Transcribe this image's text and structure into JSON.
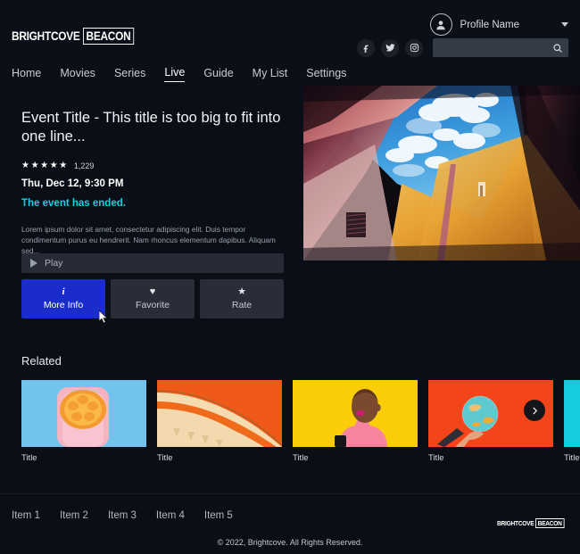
{
  "brand": {
    "logo_word": "BRIGHTCOVE",
    "logo_box": "BEACON"
  },
  "header": {
    "profile_name": "Profile Name",
    "profile_icon": "user-avatar-icon",
    "caret_icon": "chevron-down-icon",
    "social": [
      {
        "name": "facebook-icon",
        "glyph": "f"
      },
      {
        "name": "twitter-icon",
        "glyph": "t"
      },
      {
        "name": "instagram-icon",
        "glyph": "i"
      }
    ],
    "search": {
      "value": "",
      "placeholder": "",
      "icon": "search-icon"
    },
    "nav": [
      {
        "label": "Home",
        "active": false
      },
      {
        "label": "Movies",
        "active": false
      },
      {
        "label": "Series",
        "active": false
      },
      {
        "label": "Live",
        "active": true
      },
      {
        "label": "Guide",
        "active": false
      },
      {
        "label": "My List",
        "active": false
      },
      {
        "label": "Settings",
        "active": false
      }
    ]
  },
  "hero": {
    "title": "Event Title - This title is too big to fit into one line...",
    "stars": "★★★★★",
    "rating_value": 5,
    "rating_count": "1,229",
    "date": "Thu, Dec 12, 9:30 PM",
    "status": "The event has ended.",
    "status_color": "#17cfe0",
    "description": "Lorem ipsum dolor sit amet, consectetur adipiscing elit. Duis tempor condimentum purus eu hendrerit. Nam rhoncus elementum dapibus. Aliquam sed...",
    "image_alt": "upward-view-of-buildings-and-sky"
  },
  "actions": {
    "play": {
      "label": "Play",
      "icon": "play-triangle-icon"
    },
    "buttons": [
      {
        "label": "More Info",
        "icon": "info-icon",
        "glyph": "i",
        "primary": true,
        "accent": "#1a2cc9"
      },
      {
        "label": "Favorite",
        "icon": "heart-icon",
        "glyph": "♥",
        "primary": false
      },
      {
        "label": "Rate",
        "icon": "star-icon",
        "glyph": "★",
        "primary": false
      }
    ]
  },
  "related": {
    "heading": "Related",
    "next_icon": "chevron-right-icon",
    "cards": [
      {
        "title": "Title",
        "thumb": "orange-slice-on-pink-blue"
      },
      {
        "title": "Title",
        "thumb": "orange-architecture-arch"
      },
      {
        "title": "Title",
        "thumb": "woman-on-yellow-background"
      },
      {
        "title": "Title",
        "thumb": "hand-holding-globe-on-red"
      },
      {
        "title": "Title",
        "thumb": "cyan-partial-card"
      }
    ]
  },
  "footer": {
    "items": [
      "Item 1",
      "Item 2",
      "Item 3",
      "Item 4",
      "Item 5"
    ],
    "copyright": "© 2022, Brightcove. All Rights Reserved."
  }
}
